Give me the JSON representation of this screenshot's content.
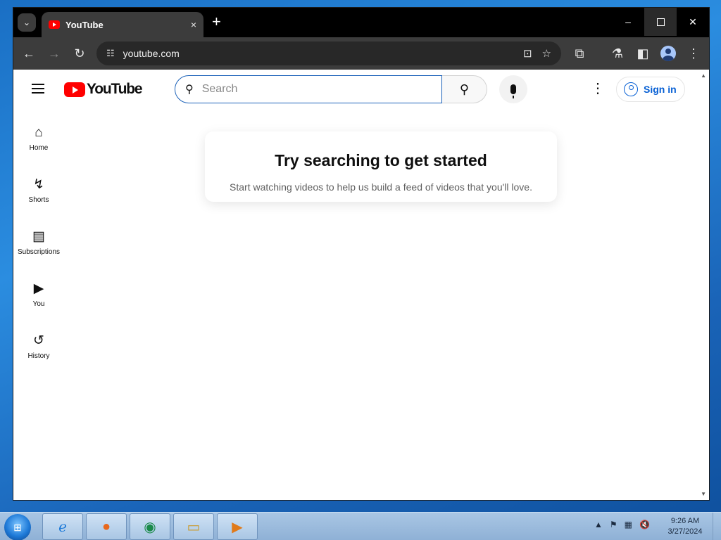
{
  "browser": {
    "tab_title": "YouTube",
    "tab_close": "×",
    "new_tab": "+",
    "url": "youtube.com",
    "window_controls": {
      "minimize": "–",
      "close": "✕"
    }
  },
  "youtube": {
    "logo_text": "YouTube",
    "search_placeholder": "Search",
    "sign_in": "Sign in",
    "guide": [
      {
        "label": "Home",
        "icon": "home-icon"
      },
      {
        "label": "Shorts",
        "icon": "shorts-icon"
      },
      {
        "label": "Subscriptions",
        "icon": "subscriptions-icon"
      },
      {
        "label": "You",
        "icon": "you-icon"
      },
      {
        "label": "History",
        "icon": "history-icon"
      }
    ],
    "empty_state": {
      "title": "Try searching to get started",
      "subtitle": "Start watching videos to help us build a feed of videos that you'll love."
    }
  },
  "taskbar": {
    "time": "9:26 AM",
    "date": "3/27/2024"
  },
  "colors": {
    "youtube_red": "#ff0000",
    "link_blue": "#065fd4",
    "chrome_dark": "#3c3c3c"
  }
}
